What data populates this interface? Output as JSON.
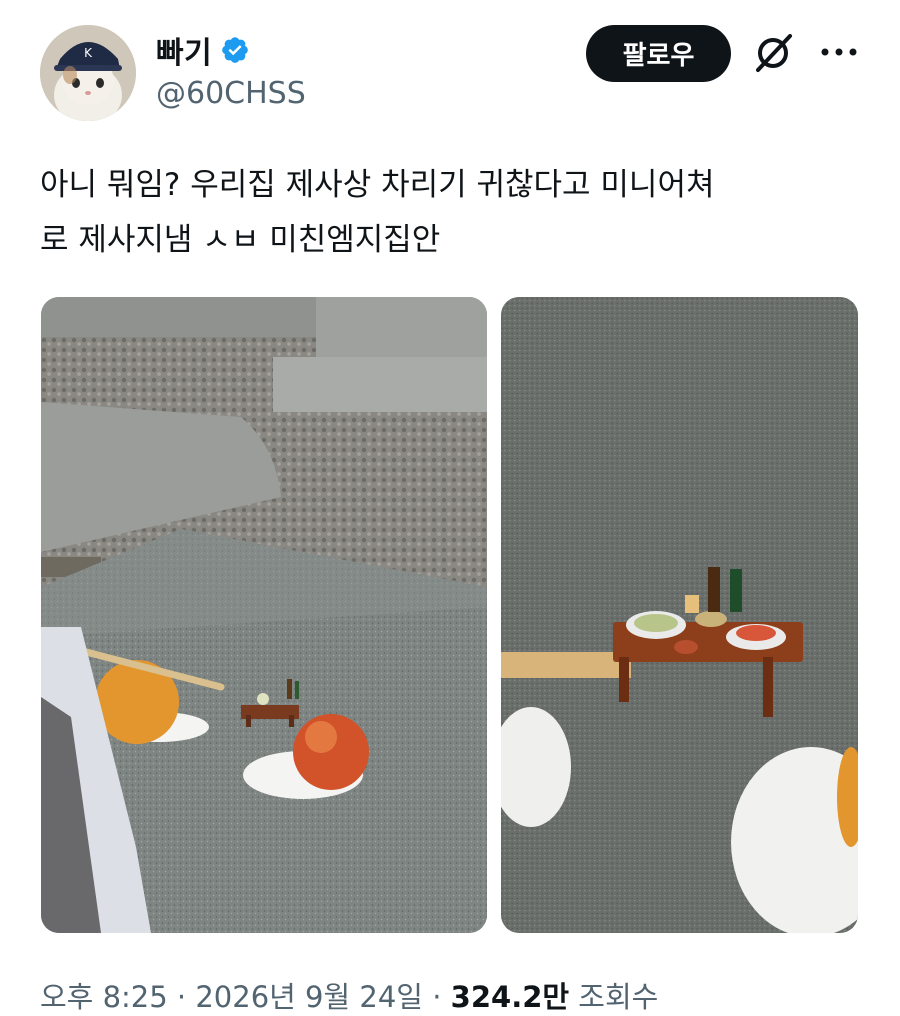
{
  "author": {
    "display_name": "빠기",
    "handle": "@60CHSS",
    "verified": true,
    "avatar_icon": "cat-in-cap-avatar"
  },
  "actions": {
    "follow_label": "팔로우",
    "grok_icon": "slash-circle-icon",
    "more_icon": "ellipsis-icon"
  },
  "tweet": {
    "text": "아니 뭐임? 우리집 제사상 차리기 귀찮다고 미니어쳐\n로 제사지냄 ㅅㅂ 미친엠지집안"
  },
  "media": [
    {
      "subject": "granite-grave-miniature-table-with-pear-and-apple"
    },
    {
      "subject": "closeup-miniature-ancestral-rite-table-on-granite"
    }
  ],
  "meta": {
    "time": "오후 8:25",
    "separator": "·",
    "date": "2026년 9월 24일",
    "views_count": "324.2만",
    "views_label": "조회수"
  },
  "colors": {
    "text_primary": "#0f1419",
    "text_secondary": "#536471",
    "verified_blue": "#1d9bf0",
    "follow_bg": "#0f1419"
  }
}
